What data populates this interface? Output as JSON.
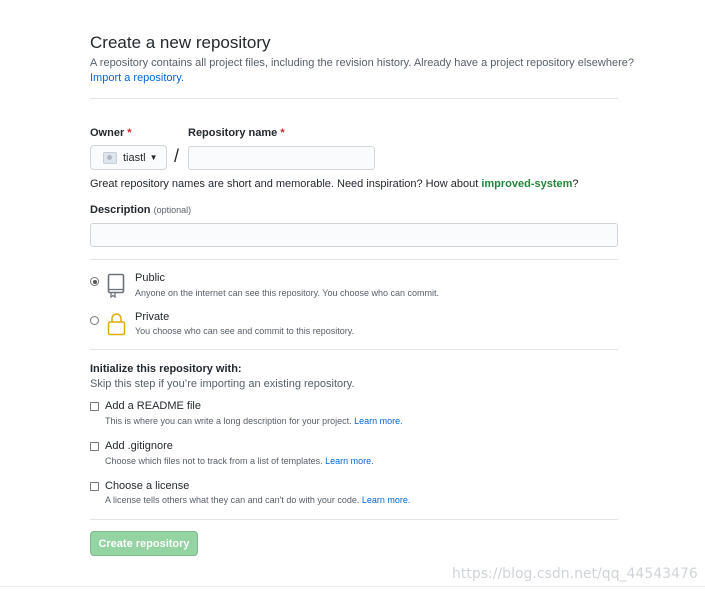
{
  "header": {
    "title": "Create a new repository",
    "subtitle": "A repository contains all project files, including the revision history. Already have a project repository elsewhere?",
    "import_link": "Import a repository."
  },
  "owner": {
    "label": "Owner",
    "required_mark": "*",
    "value": "tiastl"
  },
  "separator": "/",
  "repo_name": {
    "label": "Repository name",
    "required_mark": "*",
    "value": "",
    "placeholder": ""
  },
  "hint": {
    "text": "Great repository names are short and memorable. Need inspiration? How about ",
    "suggestion": "improved-system",
    "suffix": "?"
  },
  "description": {
    "label": "Description",
    "optional": "(optional)",
    "value": "",
    "placeholder": ""
  },
  "visibility": {
    "selected": "public",
    "options": [
      {
        "title": "Public",
        "desc": "Anyone on the internet can see this repository. You choose who can commit.",
        "icon": "repo-icon"
      },
      {
        "title": "Private",
        "desc": "You choose who can see and commit to this repository.",
        "icon": "lock-icon"
      }
    ]
  },
  "initialize": {
    "title": "Initialize this repository with:",
    "subtitle": "Skip this step if you’re importing an existing repository.",
    "options": [
      {
        "title": "Add a README file",
        "desc": "This is where you can write a long description for your project.",
        "link": "Learn more.",
        "checked": false
      },
      {
        "title": "Add .gitignore",
        "desc": "Choose which files not to track from a list of templates.",
        "link": "Learn more.",
        "checked": false
      },
      {
        "title": "Choose a license",
        "desc": "A license tells others what they can and can't do with your code.",
        "link": "Learn more.",
        "checked": false
      }
    ]
  },
  "submit": {
    "label": "Create repository"
  },
  "watermark": "https://blog.csdn.net/qq_44543476",
  "colors": {
    "link": "#0366d6",
    "required": "#cb2431",
    "suggestion": "#22863a",
    "button_disabled": "#94d3a2"
  }
}
